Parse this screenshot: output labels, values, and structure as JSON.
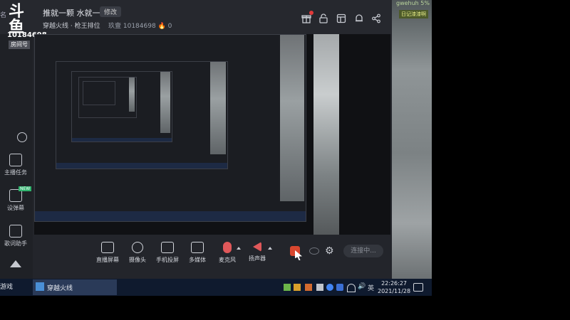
{
  "app": {
    "cut_name": "名",
    "logo_main": "斗鱼",
    "logo_sub": "房间号",
    "room_id": "10184698",
    "title": "推就一颗 水就一枪",
    "edit_label": "修改",
    "category": "穿越火线 · 枪王排位",
    "stats": "玖壹 10184698 🔥 0"
  },
  "sidebar": {
    "items": [
      {
        "label": "主播任务",
        "icon": "clipboard-icon"
      },
      {
        "label": "设弹幕",
        "icon": "danmu-icon",
        "badge": "NEW"
      },
      {
        "label": "歌词助手",
        "icon": "lyrics-icon"
      }
    ]
  },
  "toolbar": {
    "items": [
      {
        "label": "直播屏幕",
        "icon": "screen-icon"
      },
      {
        "label": "摄像头",
        "icon": "camera-icon"
      },
      {
        "label": "手机投屏",
        "icon": "phone-cast-icon"
      },
      {
        "label": "多媒体",
        "icon": "media-icon"
      },
      {
        "label": "麦克风",
        "icon": "microphone-icon"
      },
      {
        "label": "扬声器",
        "icon": "speaker-icon"
      }
    ],
    "connect_label": "连接中..."
  },
  "camera": {
    "tag": "gwehuh 5%",
    "badge": "日记漆漆啊"
  },
  "taskbar": {
    "start_label": "游戏",
    "app_label": "穿越火线",
    "ime": "英",
    "time": "22:26:27",
    "date": "2021/11/28"
  },
  "colors": {
    "accent": "#d8472f",
    "window_bg": "#23252b",
    "taskbar_bg": "#0f1a2e"
  }
}
